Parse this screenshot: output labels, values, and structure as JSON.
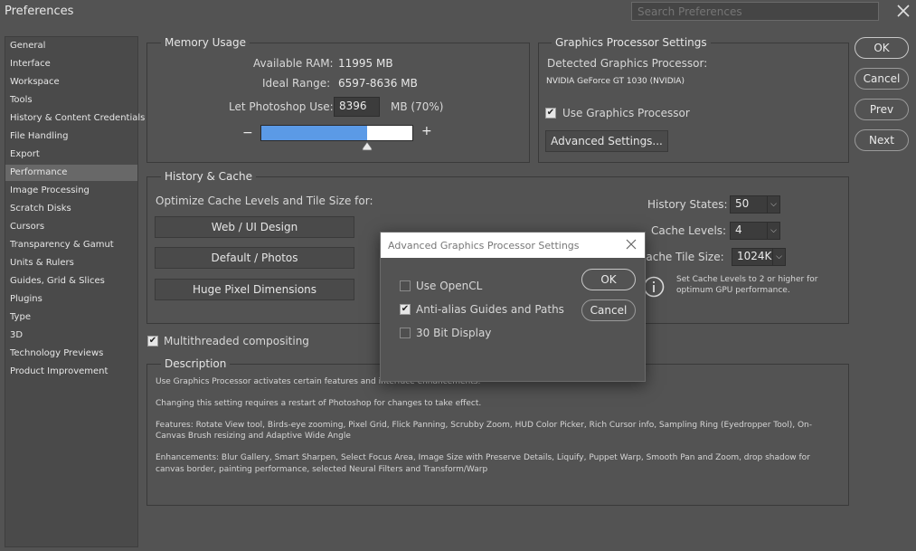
{
  "window": {
    "title": "Preferences"
  },
  "search": {
    "placeholder": "Search Preferences"
  },
  "sidebar": {
    "items": [
      "General",
      "Interface",
      "Workspace",
      "Tools",
      "History & Content Credentials",
      "File Handling",
      "Export",
      "Performance",
      "Image Processing",
      "Scratch Disks",
      "Cursors",
      "Transparency & Gamut",
      "Units & Rulers",
      "Guides, Grid & Slices",
      "Plugins",
      "Type",
      "3D",
      "Technology Previews",
      "Product Improvement"
    ],
    "active_index": 7
  },
  "memory": {
    "title": "Memory Usage",
    "available_label": "Available RAM:",
    "available_value": "11995 MB",
    "ideal_label": "Ideal Range:",
    "ideal_value": "6597-8636 MB",
    "let_label": "Let Photoshop Use:",
    "let_value": "8396",
    "unit": "MB (70%)",
    "percent": 70,
    "minus": "−",
    "plus": "+"
  },
  "gpu": {
    "title": "Graphics Processor Settings",
    "detected_label": "Detected Graphics Processor:",
    "detected_value": "NVIDIA GeForce GT 1030 (NVIDIA)",
    "use_label": "Use Graphics Processor",
    "use_checked": true,
    "advanced_btn": "Advanced Settings..."
  },
  "actions": {
    "ok": "OK",
    "cancel": "Cancel",
    "prev": "Prev",
    "next": "Next"
  },
  "history": {
    "title": "History & Cache",
    "optimize_label": "Optimize Cache Levels and Tile Size for:",
    "web_btn": "Web / UI Design",
    "default_btn": "Default / Photos",
    "huge_btn": "Huge Pixel Dimensions",
    "states_label": "History States:",
    "states_value": "50",
    "levels_label": "Cache Levels:",
    "levels_value": "4",
    "tile_label": "Cache Tile Size:",
    "tile_value": "1024K",
    "info_line1": "Set Cache Levels to 2 or higher for",
    "info_line2": "optimum GPU performance."
  },
  "multithreaded": {
    "label": "Multithreaded compositing",
    "checked": true
  },
  "description": {
    "title": "Description",
    "p1": "Use Graphics Processor activates certain features and interface enhancements.",
    "p2": "Changing this setting requires a restart of Photoshop for changes to take effect.",
    "p3a": "Features: Rotate View tool, Birds-eye zooming, Pixel Grid, Flick Panning, Scrubby Zoom, HUD Color Picker, Rich Cursor info, Sampling Ring (Eyedropper Tool), On-",
    "p3b": "Canvas Brush resizing and Adaptive Wide Angle",
    "p4a": "Enhancements: Blur Gallery, Smart Sharpen, Select Focus Area, Image Size with Preserve Details, Liquify, Puppet Warp, Smooth Pan and Zoom, drop shadow for",
    "p4b": "canvas border, painting performance, selected Neural Filters and Transform/Warp"
  },
  "modal": {
    "title": "Advanced Graphics Processor Settings",
    "opencl_label": "Use OpenCL",
    "opencl_checked": false,
    "antialias_label": "Anti-alias Guides and Paths",
    "antialias_checked": true,
    "bit30_label": "30 Bit Display",
    "bit30_checked": false,
    "ok": "OK",
    "cancel": "Cancel"
  },
  "colors": {
    "slider_fill": "#5b9ae6",
    "panel_bg": "#535353"
  }
}
